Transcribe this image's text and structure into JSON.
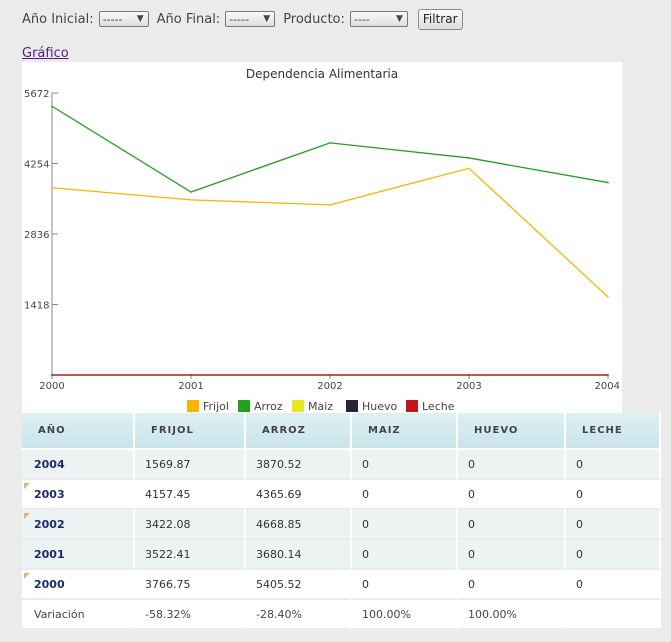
{
  "filters": {
    "start_label": "Año Inicial:",
    "start_value": "-----",
    "end_label": "Año Final:",
    "end_value": "-----",
    "product_label": "Producto:",
    "product_value": "----",
    "filter_button": "Filtrar"
  },
  "chart_link": "Gráfico",
  "chart_data": {
    "type": "line",
    "title": "Dependencia Alimentaria",
    "x": [
      "2000",
      "2001",
      "2002",
      "2003",
      "2004"
    ],
    "y_ticks": [
      "1418",
      "2836",
      "4254",
      "5672"
    ],
    "ylim": [
      0,
      5672
    ],
    "legend_position": "bottom",
    "series": [
      {
        "name": "Frijol",
        "color": "#f7b500",
        "values": [
          3766.75,
          3522.41,
          3422.08,
          4157.45,
          1569.87
        ]
      },
      {
        "name": "Arroz",
        "color": "#22a01f",
        "values": [
          5405.52,
          3680.14,
          4668.85,
          4365.69,
          3870.52
        ]
      },
      {
        "name": "Maiz",
        "color": "#e8e820",
        "values": [
          0,
          0,
          0,
          0,
          0
        ]
      },
      {
        "name": "Huevo",
        "color": "#2a2438",
        "values": [
          0,
          0,
          0,
          0,
          0
        ]
      },
      {
        "name": "Leche",
        "color": "#c4141c",
        "values": [
          0,
          0,
          0,
          0,
          0
        ]
      }
    ]
  },
  "table": {
    "headers": [
      "AÑO",
      "FRIJOL",
      "ARROZ",
      "MAIZ",
      "HUEVO",
      "LECHE"
    ],
    "rows": [
      [
        "2004",
        "1569.87",
        "3870.52",
        "0",
        "0",
        "0"
      ],
      [
        "2003",
        "4157.45",
        "4365.69",
        "0",
        "0",
        "0"
      ],
      [
        "2002",
        "3422.08",
        "4668.85",
        "0",
        "0",
        "0"
      ],
      [
        "2001",
        "3522.41",
        "3680.14",
        "0",
        "0",
        "0"
      ],
      [
        "2000",
        "3766.75",
        "5405.52",
        "0",
        "0",
        "0"
      ]
    ],
    "variation": [
      "Variación",
      "-58.32%",
      "-28.40%",
      "100.00%",
      "100.00%",
      ""
    ]
  }
}
